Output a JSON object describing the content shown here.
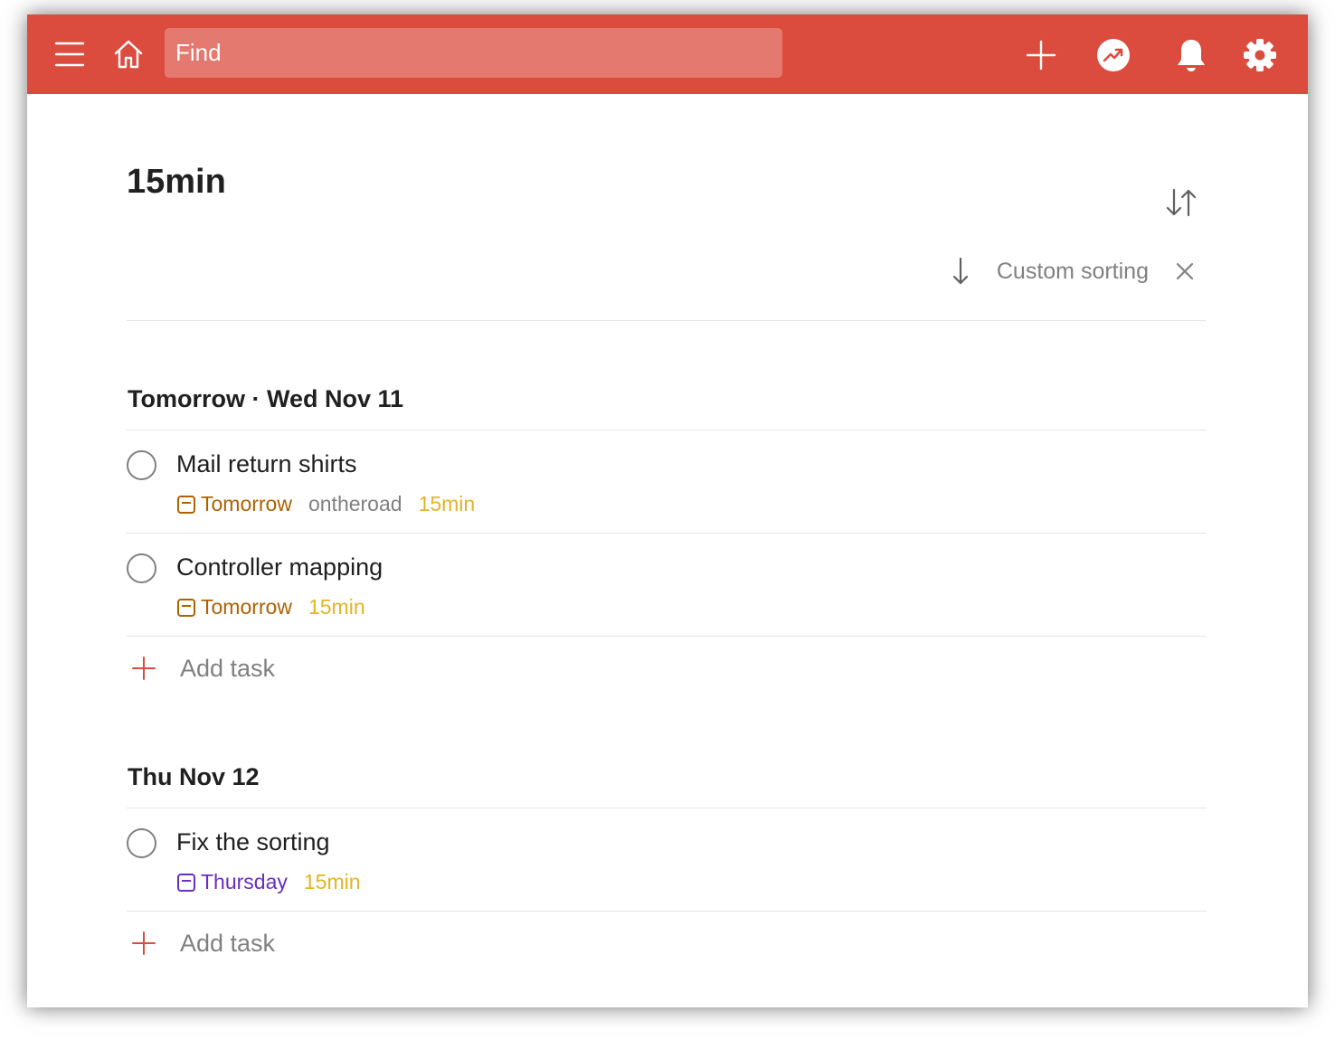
{
  "colors": {
    "brand": "#db4c3f",
    "tomorrow": "#ad6200",
    "thursday": "#692ec2",
    "label": "#e3b425",
    "muted": "#808080",
    "text": "#202020"
  },
  "topbar": {
    "icons": [
      "menu-icon",
      "home-icon",
      "add-icon",
      "productivity-icon",
      "bell-icon",
      "settings-icon"
    ],
    "search_placeholder": "Find"
  },
  "page": {
    "title": "15min",
    "sort": {
      "label": "Custom sorting",
      "direction": "descending"
    }
  },
  "sections": [
    {
      "header": "Tomorrow · Wed Nov 11",
      "tasks": [
        {
          "title": "Mail return shirts",
          "due": "Tomorrow",
          "project": "ontheroad",
          "label": "15min"
        },
        {
          "title": "Controller mapping",
          "due": "Tomorrow",
          "label": "15min"
        }
      ],
      "add_task_label": "Add task"
    },
    {
      "header": "Thu Nov 12",
      "tasks": [
        {
          "title": "Fix the sorting",
          "due": "Thursday",
          "label": "15min"
        }
      ],
      "add_task_label": "Add task"
    }
  ]
}
